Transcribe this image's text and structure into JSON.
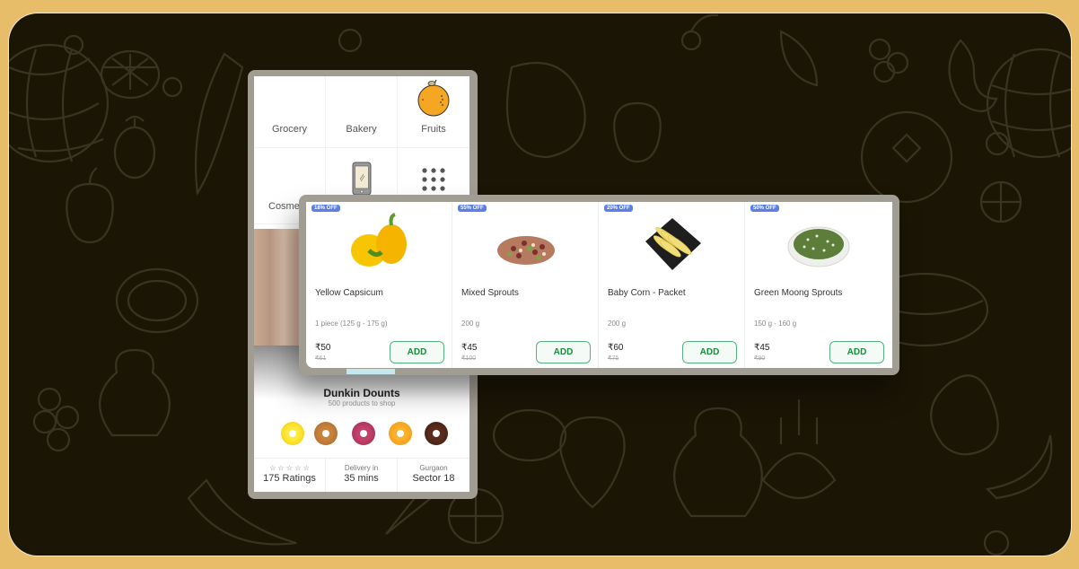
{
  "colors": {
    "page_border": "#E8BD6A",
    "panel_bg": "#1A1505",
    "doodle_stroke": "#3a3320",
    "device_frame": "#a19d93",
    "badge_blue": "#5b7fe6",
    "add_green": "#1a8a3c"
  },
  "phone": {
    "categories": [
      {
        "label": "Grocery",
        "icon": "none"
      },
      {
        "label": "Bakery",
        "icon": "none"
      },
      {
        "label": "Fruits",
        "icon": "orange-icon"
      },
      {
        "label": "Cosmeti",
        "icon": "none"
      },
      {
        "label": "",
        "icon": "mobile-phone-icon"
      },
      {
        "label": "",
        "icon": "grid-dots-icon"
      }
    ],
    "store": {
      "name": "Dunkin Dounts",
      "subtitle": "500 products to shop"
    },
    "stats": [
      {
        "top": "☆ ☆ ☆ ☆ ☆",
        "bottom": "175 Ratings"
      },
      {
        "top": "Delivery in",
        "bottom": "35 mins"
      },
      {
        "top": "Gurgaon",
        "bottom": "Sector 18"
      }
    ]
  },
  "products": [
    {
      "badge": "18% OFF",
      "name": "Yellow Capsicum",
      "qty": "1 piece (125 g - 175 g)",
      "price": "₹50",
      "mrp": "₹61",
      "add_label": "ADD"
    },
    {
      "badge": "55% OFF",
      "name": "Mixed Sprouts",
      "qty": "200 g",
      "price": "₹45",
      "mrp": "₹100",
      "add_label": "ADD"
    },
    {
      "badge": "20% OFF",
      "name": "Baby Corn - Packet",
      "qty": "200 g",
      "price": "₹60",
      "mrp": "₹75",
      "add_label": "ADD"
    },
    {
      "badge": "50% OFF",
      "name": "Green Moong Sprouts",
      "qty": "150 g - 160 g",
      "price": "₹45",
      "mrp": "₹90",
      "add_label": "ADD"
    }
  ]
}
